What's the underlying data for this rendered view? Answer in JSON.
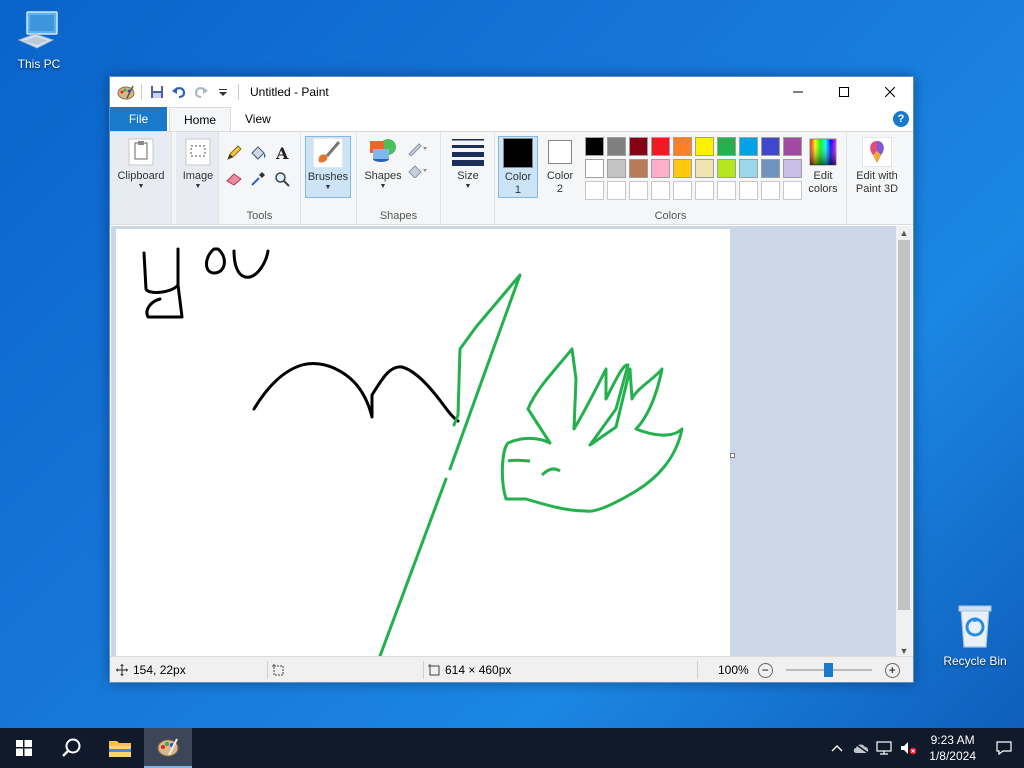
{
  "desktop": {
    "this_pc_label": "This PC",
    "recycle_bin_label": "Recycle Bin"
  },
  "window": {
    "title": "Untitled - Paint",
    "tabs": [
      {
        "label": "File"
      },
      {
        "label": "Home"
      },
      {
        "label": "View"
      }
    ],
    "help_label": "?"
  },
  "ribbon": {
    "clipboard": {
      "label": "Clipboard"
    },
    "image": {
      "label": "Image"
    },
    "tools_group_label": "Tools",
    "brushes": {
      "label": "Brushes"
    },
    "shapes": {
      "label": "Shapes"
    },
    "shapes_group_label": "Shapes",
    "size": {
      "label": "Size"
    },
    "color1": {
      "label_line1": "Color",
      "label_line2": "1",
      "color": "#000000"
    },
    "color2": {
      "label_line1": "Color",
      "label_line2": "2",
      "color": "#ffffff"
    },
    "colors_group_label": "Colors",
    "edit_colors": {
      "label_line1": "Edit",
      "label_line2": "colors"
    },
    "edit_paint3d": {
      "label_line1": "Edit with",
      "label_line2": "Paint 3D"
    },
    "palette_row1": [
      "#000000",
      "#7f7f7f",
      "#880015",
      "#ed1c24",
      "#ff7f27",
      "#fff200",
      "#22b14c",
      "#00a2e8",
      "#3f48cc",
      "#a349a4"
    ],
    "palette_row2": [
      "#ffffff",
      "#c3c3c3",
      "#b97a57",
      "#ffaec9",
      "#ffc90e",
      "#efe4b0",
      "#b5e61d",
      "#99d9ea",
      "#7092be",
      "#c8bfe7"
    ]
  },
  "statusbar": {
    "cursor_pos": "154, 22px",
    "canvas_size": "614 × 460px",
    "zoom": "100%"
  },
  "taskbar": {
    "time": "9:23 AM",
    "date": "1/8/2024"
  },
  "drawing": {
    "black_stroke": "#000000",
    "green_stroke": "#22b14c"
  }
}
